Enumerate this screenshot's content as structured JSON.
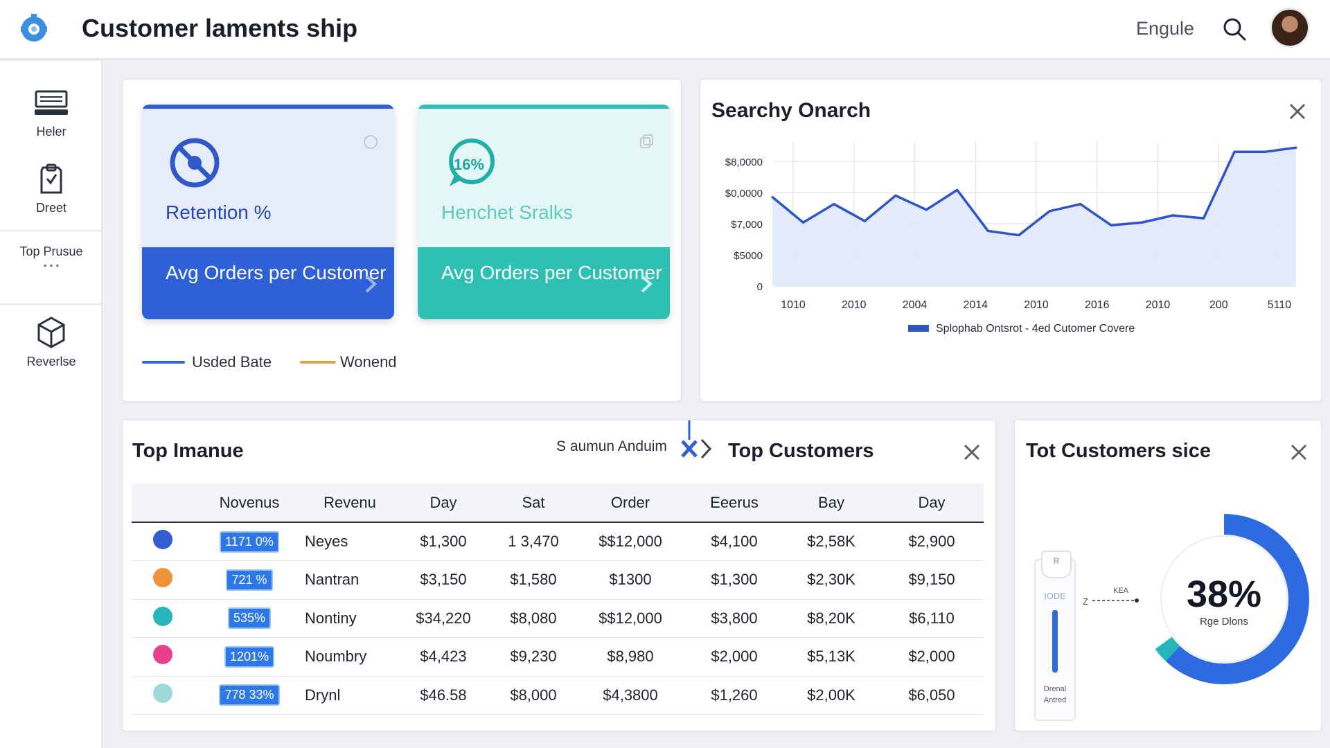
{
  "header": {
    "title": "Customer laments ship",
    "language": "Engule",
    "logo": "gear-logo",
    "search_icon": "search-icon",
    "avatar": "user-avatar"
  },
  "sidebar": {
    "items": [
      {
        "label": "Heler",
        "icon": "keyboard-icon"
      },
      {
        "label": "Dreet",
        "icon": "clipboard-icon"
      },
      {
        "label": "Top Prusue",
        "icon": "more-dots"
      },
      {
        "label": "Reverlse",
        "icon": "cube-icon"
      }
    ]
  },
  "kpi_cards": [
    {
      "top_label": "Retention %",
      "bottom_label": "Avg Orders per Customer",
      "icon": "blocked-icon",
      "color": "#3060d8"
    },
    {
      "top_label": "Henchet Sralks",
      "badge": "16%",
      "bottom_label": "Avg Orders per Customer",
      "icon": "chat-percent-icon",
      "color": "#2fc0b4"
    }
  ],
  "kpi_legend": [
    {
      "label": "Usded Bate",
      "color": "#2f65d8"
    },
    {
      "label": "Wonend",
      "color": "#e8a24a"
    }
  ],
  "line_chart_panel": {
    "title": "Searchy Onarch",
    "legend": "Splophab Ontsrot - 4ed Cutomer Covere"
  },
  "chart_data": {
    "type": "area",
    "title": "Searchy Onarch",
    "x_tick_labels": [
      "1010",
      "2010",
      "2004",
      "2014",
      "2010",
      "2016",
      "2010",
      "200",
      "5110"
    ],
    "y_tick_labels": [
      "$8,0000",
      "$0,0000",
      "$7,000",
      "$5000",
      "0"
    ],
    "series": [
      {
        "name": "Splophab Ontsrot - 4ed Cutomer Covere",
        "color": "#2f54c8",
        "values": [
          0.63,
          0.45,
          0.58,
          0.46,
          0.64,
          0.54,
          0.68,
          0.39,
          0.36,
          0.53,
          0.58,
          0.43,
          0.45,
          0.5,
          0.48,
          0.95,
          0.95,
          0.98
        ]
      }
    ],
    "grid": true
  },
  "table_panel": {
    "title": "Top Imanue",
    "filter_label": "S aumun Anduim",
    "secondary_title": "Top Customers",
    "columns": [
      "",
      "Novenus",
      "Revenu",
      "Day",
      "Sat",
      "Order",
      "Eeerus",
      "Bay",
      "Day"
    ],
    "rows": [
      {
        "color": "#2f5fd0",
        "pct": "1171 0%",
        "name": "Neyes",
        "c1": "$1,300",
        "c2": "1 3,470",
        "c3": "$$12,000",
        "c4": "$4,100",
        "c5": "$2,58K",
        "c6": "$2,900"
      },
      {
        "color": "#f0923a",
        "pct": "721 %",
        "name": "Nantran",
        "c1": "$3,150",
        "c2": "$1,580",
        "c3": "$1300",
        "c4": "$1,300",
        "c5": "$2,30K",
        "c6": "$9,150"
      },
      {
        "color": "#26b5bb",
        "pct": "535%",
        "name": "Nontiny",
        "c1": "$34,220",
        "c2": "$8,080",
        "c3": "$$12,000",
        "c4": "$3,800",
        "c5": "$8,20K",
        "c6": "$6,110"
      },
      {
        "color": "#e8408e",
        "pct": "1201%",
        "name": "Noumbry",
        "c1": "$4,423",
        "c2": "$9,230",
        "c3": "$8,980",
        "c4": "$2,000",
        "c5": "$5,13K",
        "c6": "$2,000"
      },
      {
        "color": "#9ed9d9",
        "pct": "778 33%",
        "name": "Drynl",
        "c1": "$46.58",
        "c2": "$8,000",
        "c3": "$4,3800",
        "c4": "$1,260",
        "c5": "$2,00K",
        "c6": "$6,050"
      }
    ]
  },
  "donut_panel": {
    "title": "Tot Customers sice",
    "value": "38%",
    "value_fraction": 0.62,
    "caption": "Rge Dlons",
    "connector_label": "KEA",
    "connector_prefix": "Z",
    "device_top": "R",
    "device_label": "IODE",
    "device_caption_1": "Drenal",
    "device_caption_2": "Antred",
    "ring_color": "#2f6be0",
    "accent_color": "#26b5bb"
  }
}
